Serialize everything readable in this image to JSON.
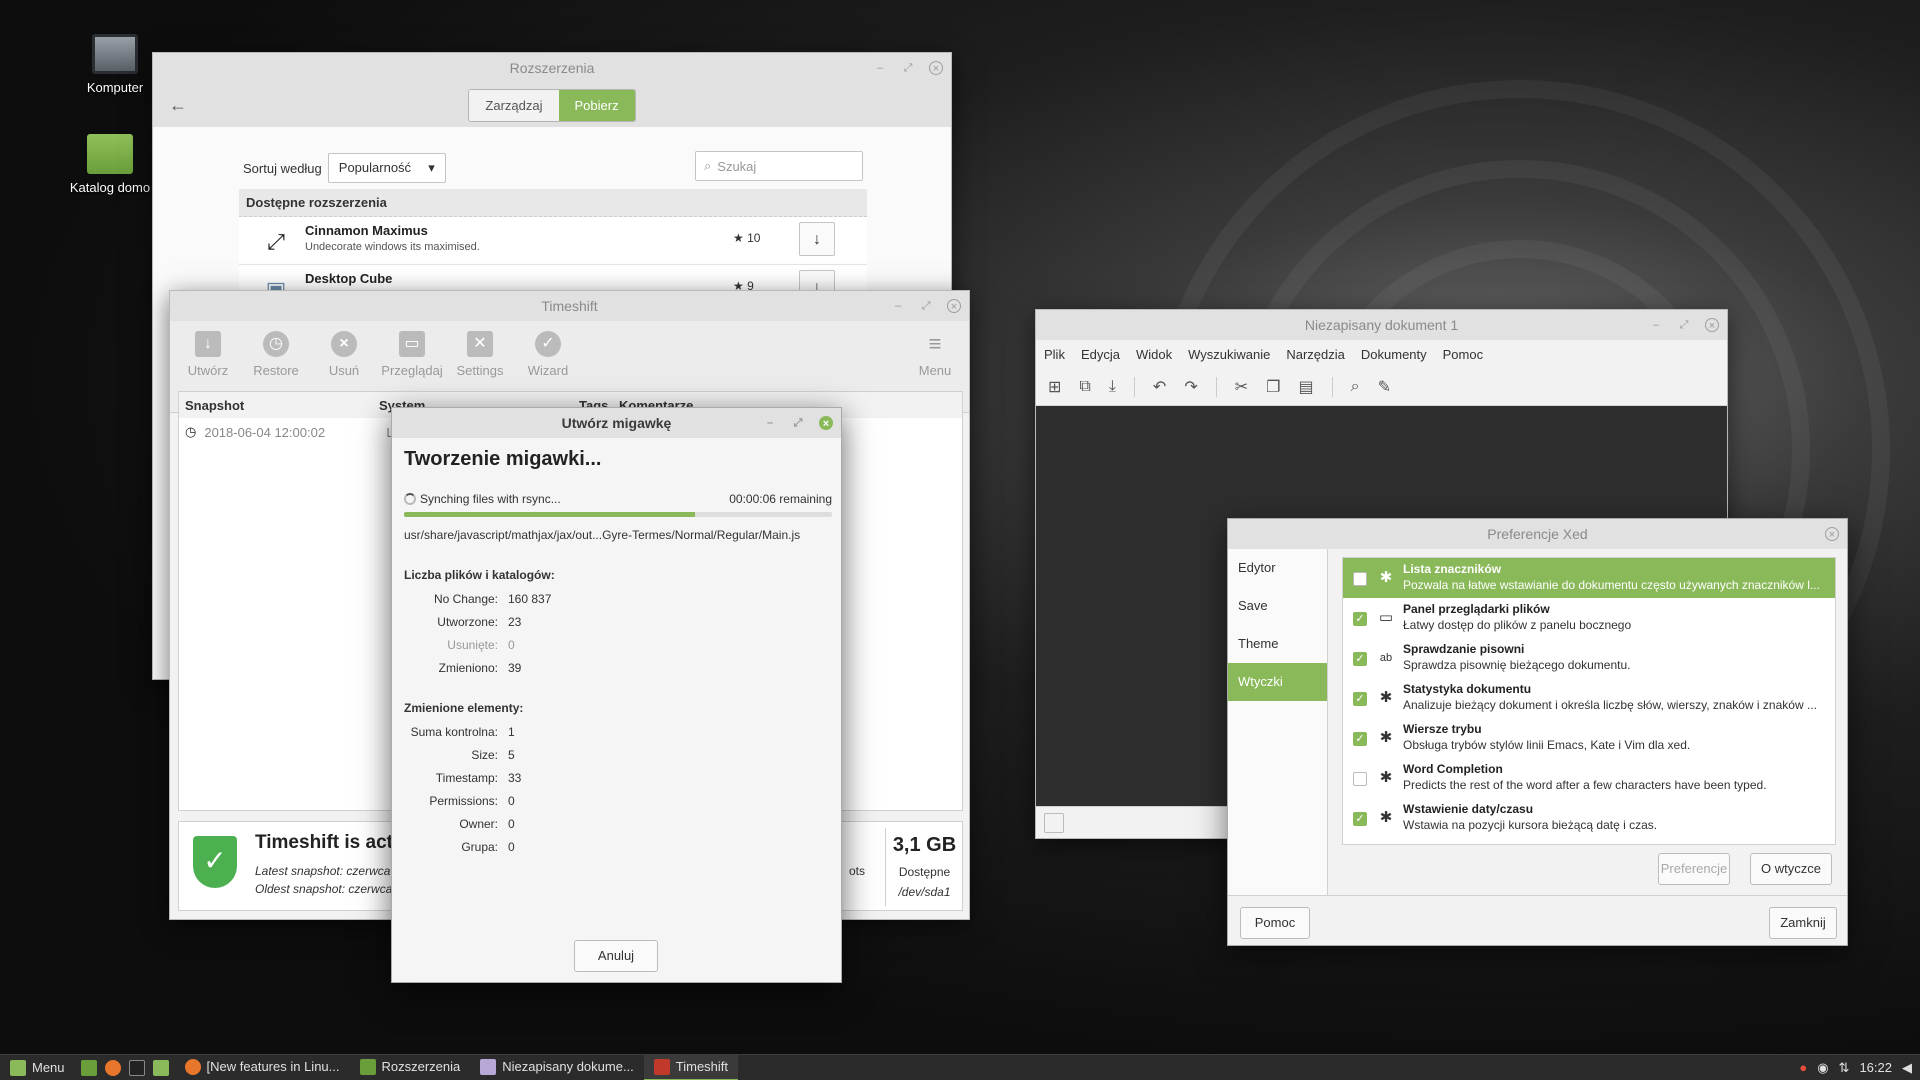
{
  "colors": {
    "accent": "#8ab95a",
    "shield": "#4caf50"
  },
  "desktop": {
    "icons": [
      {
        "label": "Komputer",
        "icon": "computer-icon"
      },
      {
        "label": "Katalog domo",
        "icon": "home-folder-icon"
      }
    ]
  },
  "extensions_window": {
    "title": "Rozszerzenia",
    "tabs": [
      "Zarządzaj",
      "Pobierz"
    ],
    "sort_label": "Sortuj według",
    "sort_value": "Popularność",
    "search_placeholder": "Szukaj",
    "list_header": "Dostępne rozszerzenia",
    "items": [
      {
        "name": "Cinnamon Maximus",
        "desc": "Undecorate windows its maximised.",
        "rating": "10"
      },
      {
        "name": "Desktop Cube",
        "desc": "",
        "rating": "9"
      }
    ]
  },
  "timeshift_window": {
    "title": "Timeshift",
    "toolbar": [
      "Utwórz",
      "Restore",
      "Usuń",
      "Przeglądaj",
      "Settings",
      "Wizard"
    ],
    "menu_label": "Menu",
    "columns": [
      "Snapshot",
      "System",
      "Tags",
      "Komentarze"
    ],
    "snapshots": [
      {
        "date": "2018-06-04 12:00:02",
        "system": "Li"
      }
    ],
    "status_title": "Timeshift is acti",
    "latest": "Latest snapshot: czerwca",
    "oldest": "Oldest snapshot: czerwca",
    "count_suffix": "ots",
    "disk_size": "3,1 GB",
    "disk_label": "Dostępne",
    "disk_device": "/dev/sda1"
  },
  "snapshot_dialog": {
    "title": "Utwórz migawkę",
    "heading": "Tworzenie migawki...",
    "status": "Synching files with rsync...",
    "remaining": "00:00:06 remaining",
    "progress": 0.68,
    "current_file": "usr/share/javascript/mathjax/jax/out...Gyre-Termes/Normal/Regular/Main.js",
    "files_header": "Liczba plików i katalogów:",
    "file_stats": [
      {
        "label": "No Change:",
        "value": "160 837",
        "muted": false
      },
      {
        "label": "Utworzone:",
        "value": "23",
        "muted": false
      },
      {
        "label": "Usunięte:",
        "value": "0",
        "muted": true
      },
      {
        "label": "Zmieniono:",
        "value": "39",
        "muted": false
      }
    ],
    "changed_header": "Zmienione elementy:",
    "changed_stats": [
      {
        "label": "Suma kontrolna:",
        "value": "1"
      },
      {
        "label": "Size:",
        "value": "5"
      },
      {
        "label": "Timestamp:",
        "value": "33"
      },
      {
        "label": "Permissions:",
        "value": "0"
      },
      {
        "label": "Owner:",
        "value": "0"
      },
      {
        "label": "Grupa:",
        "value": "0"
      }
    ],
    "cancel": "Anuluj"
  },
  "xed_window": {
    "title": "Niezapisany dokument 1",
    "menu": [
      "Plik",
      "Edycja",
      "Widok",
      "Wyszukiwanie",
      "Narzędzia",
      "Dokumenty",
      "Pomoc"
    ]
  },
  "xed_prefs": {
    "title": "Preferencje Xed",
    "sidebar": [
      "Edytor",
      "Save",
      "Theme",
      "Wtyczki"
    ],
    "plugins": [
      {
        "name": "Lista znaczników",
        "desc": "Pozwala na łatwe wstawianie do dokumentu często używanych znaczników l...",
        "on": false,
        "icon": "plugin-icon"
      },
      {
        "name": "Panel przeglądarki plików",
        "desc": "Łatwy dostęp do plików z panelu bocznego",
        "on": true,
        "icon": "folder-icon"
      },
      {
        "name": "Sprawdzanie pisowni",
        "desc": "Sprawdza pisownię bieżącego dokumentu.",
        "on": true,
        "icon": "spellcheck-icon"
      },
      {
        "name": "Statystyka dokumentu",
        "desc": "Analizuje bieżący dokument i określa liczbę słów, wierszy, znaków i znaków ...",
        "on": true,
        "icon": "plugin-icon"
      },
      {
        "name": "Wiersze trybu",
        "desc": "Obsługa trybów stylów linii Emacs, Kate i Vim dla xed.",
        "on": true,
        "icon": "plugin-icon"
      },
      {
        "name": "Word Completion",
        "desc": "Predicts the rest of the word after a few characters have been typed.",
        "on": false,
        "icon": "plugin-icon"
      },
      {
        "name": "Wstawienie daty/czasu",
        "desc": "Wstawia na pozycji kursora bieżącą datę i czas.",
        "on": true,
        "icon": "plugin-icon"
      }
    ],
    "prefs_button": "Preferencje",
    "about_button": "O wtyczce",
    "help_button": "Pomoc",
    "close_button": "Zamknij"
  },
  "taskbar": {
    "menu_label": "Menu",
    "tasks": [
      {
        "label": "[New features in Linu...",
        "icon": "firefox-icon"
      },
      {
        "label": "Rozszerzenia",
        "icon": "extensions-icon"
      },
      {
        "label": "Niezapisany dokume...",
        "icon": "text-editor-icon"
      },
      {
        "label": "Timeshift",
        "icon": "timeshift-icon"
      }
    ],
    "clock": "16:22"
  }
}
